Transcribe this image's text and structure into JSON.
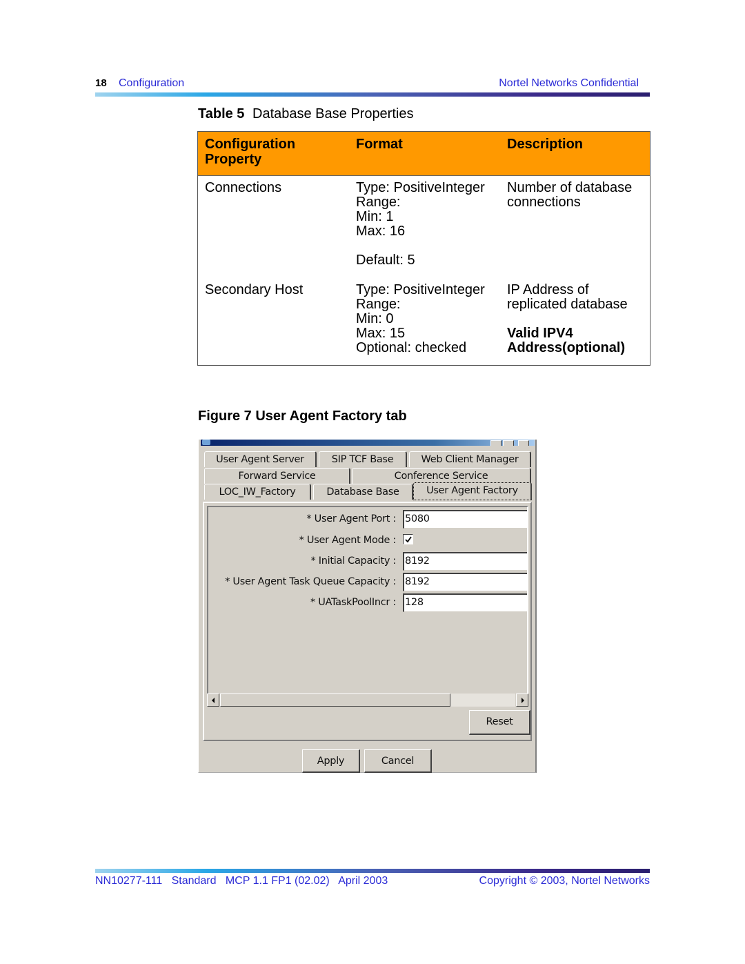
{
  "header": {
    "page_number": "18",
    "section": "Configuration",
    "confidentiality": "Nortel Networks Confidential"
  },
  "table": {
    "caption_label": "Table 5",
    "caption_title": "Database Base Properties",
    "header_color": "#ff9900",
    "columns": [
      "Configuration Property",
      "Format",
      "Description"
    ],
    "rows": [
      {
        "property": "Connections",
        "format": [
          "Type: PositiveInteger",
          "Range:",
          "Min: 1",
          "Max: 16",
          "",
          "Default: 5"
        ],
        "description": [
          "Number of database",
          "connections"
        ],
        "description_bold": []
      },
      {
        "property": "Secondary Host",
        "format": [
          "Type: PositiveInteger",
          "Range:",
          "Min: 0",
          "Max: 15",
          "Optional: checked"
        ],
        "description": [
          "IP Address of",
          "replicated database",
          ""
        ],
        "description_bold": [
          "Valid IPV4",
          "Address(optional)"
        ]
      }
    ]
  },
  "figure": {
    "caption": "Figure 7  User Agent Factory tab",
    "dialog": {
      "tabs_row1": [
        "User Agent Server",
        "SIP TCF Base",
        "Web Client Manager"
      ],
      "tabs_row2": [
        "Forward Service",
        "Conference  Service"
      ],
      "tabs_row3": [
        "LOC_IW_Factory",
        "Database Base",
        "User Agent Factory"
      ],
      "active_tab": "User Agent Factory",
      "fields": [
        {
          "label": "* User Agent Port :",
          "type": "text",
          "value": "5080"
        },
        {
          "label": "* User Agent Mode :",
          "type": "checkbox",
          "checked": true
        },
        {
          "label": "* Initial Capacity :",
          "type": "text",
          "value": "8192"
        },
        {
          "label": "* User Agent Task Queue Capacity :",
          "type": "text",
          "value": "8192"
        },
        {
          "label": "* UATaskPoolIncr :",
          "type": "text",
          "value": "128"
        }
      ],
      "buttons": {
        "reset": "Reset",
        "apply": "Apply",
        "cancel": "Cancel"
      }
    }
  },
  "footer": {
    "document_info": "NN10277-111   Standard   MCP 1.1 FP1 (02.02)   April 2003",
    "copyright": "Copyright © 2003, Nortel Networks"
  }
}
